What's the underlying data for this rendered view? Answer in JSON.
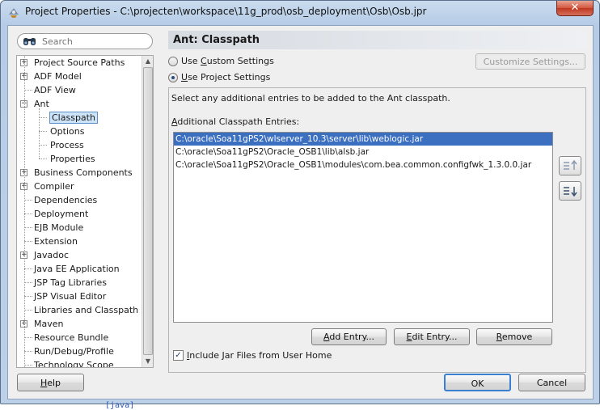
{
  "window": {
    "title": "Project Properties - C:\\projecten\\workspace\\11g_prod\\osb_deployment\\Osb\\Osb.jpr",
    "close_glyph": "✕"
  },
  "search": {
    "placeholder": "Search",
    "value": ""
  },
  "tree": {
    "items": [
      {
        "label": "Project Source Paths",
        "level": 0,
        "expandable": true,
        "selected": false
      },
      {
        "label": "ADF Model",
        "level": 0,
        "expandable": true,
        "selected": false
      },
      {
        "label": "ADF View",
        "level": 0,
        "expandable": false,
        "selected": false
      },
      {
        "label": "Ant",
        "level": 0,
        "expandable": true,
        "expanded": true,
        "selected": false
      },
      {
        "label": "Classpath",
        "level": 1,
        "expandable": false,
        "selected": true
      },
      {
        "label": "Options",
        "level": 1,
        "expandable": false,
        "selected": false
      },
      {
        "label": "Process",
        "level": 1,
        "expandable": false,
        "selected": false
      },
      {
        "label": "Properties",
        "level": 1,
        "expandable": false,
        "selected": false
      },
      {
        "label": "Business Components",
        "level": 0,
        "expandable": true,
        "selected": false
      },
      {
        "label": "Compiler",
        "level": 0,
        "expandable": true,
        "selected": false
      },
      {
        "label": "Dependencies",
        "level": 0,
        "expandable": false,
        "selected": false
      },
      {
        "label": "Deployment",
        "level": 0,
        "expandable": false,
        "selected": false
      },
      {
        "label": "EJB Module",
        "level": 0,
        "expandable": false,
        "selected": false
      },
      {
        "label": "Extension",
        "level": 0,
        "expandable": false,
        "selected": false
      },
      {
        "label": "Javadoc",
        "level": 0,
        "expandable": true,
        "selected": false
      },
      {
        "label": "Java EE Application",
        "level": 0,
        "expandable": false,
        "selected": false
      },
      {
        "label": "JSP Tag Libraries",
        "level": 0,
        "expandable": false,
        "selected": false
      },
      {
        "label": "JSP Visual Editor",
        "level": 0,
        "expandable": false,
        "selected": false
      },
      {
        "label": "Libraries and Classpath",
        "level": 0,
        "expandable": false,
        "selected": false
      },
      {
        "label": "Maven",
        "level": 0,
        "expandable": true,
        "selected": false
      },
      {
        "label": "Resource Bundle",
        "level": 0,
        "expandable": false,
        "selected": false
      },
      {
        "label": "Run/Debug/Profile",
        "level": 0,
        "expandable": false,
        "selected": false
      },
      {
        "label": "Technology Scope",
        "level": 0,
        "expandable": false,
        "selected": false
      }
    ]
  },
  "page": {
    "title": "Ant: Classpath",
    "use_custom_settings": {
      "label": "Use Custom Settings",
      "mnemonic": "C",
      "checked": false
    },
    "use_project_settings": {
      "label": "Use Project Settings",
      "mnemonic": "U",
      "checked": true
    },
    "customize_settings_label": "Customize Settings...",
    "description": "Select any additional entries to be added to the Ant classpath.",
    "entries_label": "Additional Classpath Entries:",
    "entries": [
      {
        "path": "C:\\oracle\\Soa11gPS2\\wlserver_10.3\\server\\lib\\weblogic.jar",
        "selected": true
      },
      {
        "path": "C:\\oracle\\Soa11gPS2\\Oracle_OSB1\\lib\\alsb.jar",
        "selected": false
      },
      {
        "path": "C:\\oracle\\Soa11gPS2\\Oracle_OSB1\\modules\\com.bea.common.configfwk_1.3.0.0.jar",
        "selected": false
      }
    ],
    "add_entry_label": "Add Entry...",
    "edit_entry_label": "Edit Entry...",
    "remove_label": "Remove",
    "include_jar_label": "Include Jar Files from User Home",
    "include_jar_checked": true
  },
  "footer": {
    "help_label": "Help",
    "ok_label": "OK",
    "cancel_label": "Cancel"
  },
  "background_text": "[java]"
}
